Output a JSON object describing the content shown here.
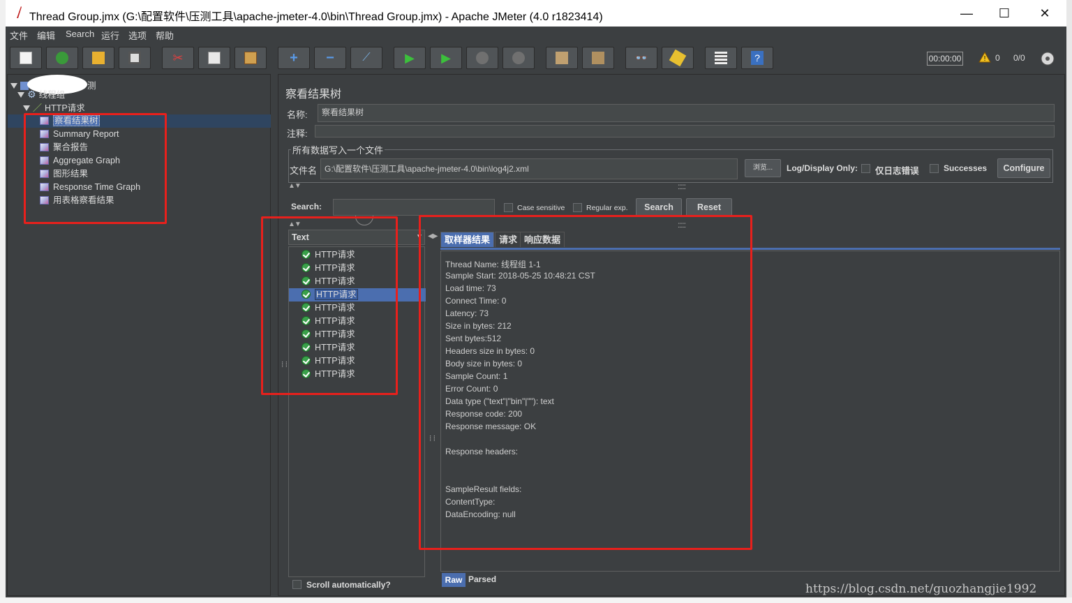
{
  "window": {
    "title": "Thread Group.jmx (G:\\配置软件\\压测工具\\apache-jmeter-4.0\\bin\\Thread Group.jmx) - Apache JMeter (4.0 r1823414)",
    "minimize": "—",
    "maximize": "☐",
    "close": "✕"
  },
  "menu": [
    "文件",
    "编辑",
    "Search",
    "运行",
    "选项",
    "帮助"
  ],
  "toolbar": {
    "timer": "00:00:00",
    "warnings": "0",
    "threads": "0/0"
  },
  "tree": {
    "root_suffix": "测",
    "thread_group": "线程组",
    "http_request": "HTTP请求",
    "listeners": [
      "察看结果树",
      "Summary Report",
      "聚合报告",
      "Aggregate Graph",
      "图形结果",
      "Response Time Graph",
      "用表格察看结果"
    ]
  },
  "panel": {
    "title": "察看结果树",
    "name_label": "名称:",
    "name_value": "察看结果树",
    "comment_label": "注释:",
    "comment_value": "",
    "file_group_label": "所有数据写入一个文件",
    "filename_label": "文件名",
    "filename_value": "G:\\配置软件\\压测工具\\apache-jmeter-4.0\\bin\\log4j2.xml",
    "browse": "浏览...",
    "log_display_only": "Log/Display Only:",
    "errors_only": "仅日志错误",
    "successes": "Successes",
    "configure": "Configure"
  },
  "search": {
    "label": "Search:",
    "value": "",
    "case_sensitive": "Case sensitive",
    "regular_exp": "Regular exp.",
    "search_button": "Search",
    "reset_button": "Reset"
  },
  "results": {
    "renderer": "Text",
    "samples": [
      "HTTP请求",
      "HTTP请求",
      "HTTP请求",
      "HTTP请求",
      "HTTP请求",
      "HTTP请求",
      "HTTP请求",
      "HTTP请求",
      "HTTP请求",
      "HTTP请求"
    ],
    "selected_index": 3,
    "scroll_auto": "Scroll automatically?",
    "tabs": [
      "取样器结果",
      "请求",
      "响应数据"
    ],
    "lines": [
      "Thread Name: 线程组 1-1",
      "Sample Start: 2018-05-25 10:48:21 CST",
      "Load time: 73",
      "Connect Time: 0",
      "Latency: 73",
      "Size in bytes: 212",
      "Sent bytes:512",
      "Headers size in bytes: 0",
      "Body size in bytes: 0",
      "Sample Count: 1",
      "Error Count: 0",
      "Data type (\"text\"|\"bin\"|\"\"): text",
      "Response code: 200",
      "Response message: OK",
      "",
      "Response headers:",
      "",
      "",
      "SampleResult fields:",
      "ContentType: ",
      "DataEncoding: null"
    ],
    "bottom_tabs": [
      "Raw",
      "Parsed"
    ]
  },
  "watermark": "https://blog.csdn.net/guozhangjie1992",
  "colors": {
    "background": "#3c3f41",
    "selection": "#4b6eaf",
    "highlight_box": "#e8201c"
  }
}
